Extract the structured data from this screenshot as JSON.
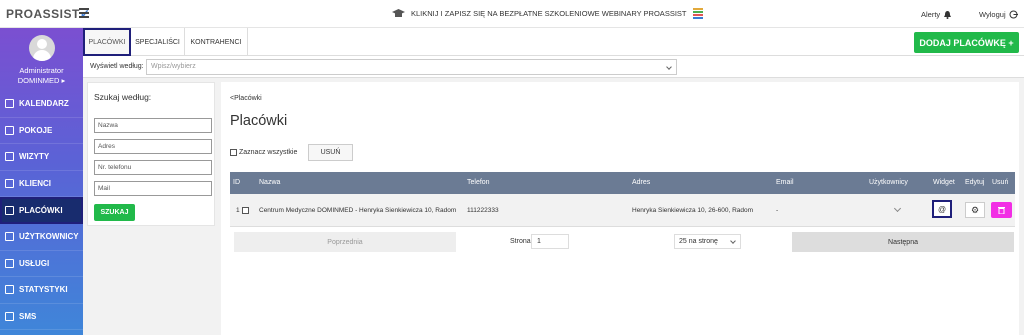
{
  "header": {
    "logo": "PROASSIST",
    "announcement": "KLIKNIJ I ZAPISZ SIĘ NA BEZPŁATNE SZKOLENIOWE WEBINARY PROASSIST",
    "alerts_label": "Alerty",
    "logout_label": "Wyloguj"
  },
  "sidebar": {
    "role": "Administrator",
    "company": "DOMINMED ▸",
    "items": [
      {
        "label": "KALENDARZ"
      },
      {
        "label": "POKOJE"
      },
      {
        "label": "WIZYTY"
      },
      {
        "label": "KLIENCI"
      },
      {
        "label": "PLACÓWKI"
      },
      {
        "label": "UŻYTKOWNICY"
      },
      {
        "label": "USŁUGI"
      },
      {
        "label": "STATYSTYKI"
      },
      {
        "label": "SMS"
      }
    ]
  },
  "tabs": [
    "PLACÓWKI",
    "SPECJALIŚCI",
    "KONTRAHENCI"
  ],
  "add_button": "DODAJ PLACÓWKĘ +",
  "filter": {
    "label": "Wyświetl według:",
    "placeholder": "Wpisz/wybierz"
  },
  "search": {
    "title": "Szukaj według:",
    "fields": [
      "Nazwa",
      "Adres",
      "Nr. telefonu",
      "Mail"
    ],
    "button": "SZUKAJ"
  },
  "content": {
    "breadcrumb": "<Placówki",
    "title": "Placówki",
    "select_all": "Zaznacz wszystkie",
    "delete_button": "USUŃ",
    "columns": [
      "ID",
      "Nazwa",
      "Telefon",
      "Adres",
      "Email",
      "Użytkownicy",
      "Widget",
      "Edytuj",
      "Usuń"
    ],
    "rows": [
      {
        "id": "1",
        "name": "Centrum Medyczne DOMINMED - Henryka Sienkiewicza 10, Radom",
        "phone": "111222333",
        "address": "Henryka Sienkiewicza 10, 26-600, Radom",
        "email": "-"
      }
    ],
    "pager": {
      "prev": "Poprzednia",
      "page_label": "Strona",
      "page_value": "1",
      "per_page": "25 na stronę",
      "next": "Następna"
    }
  }
}
